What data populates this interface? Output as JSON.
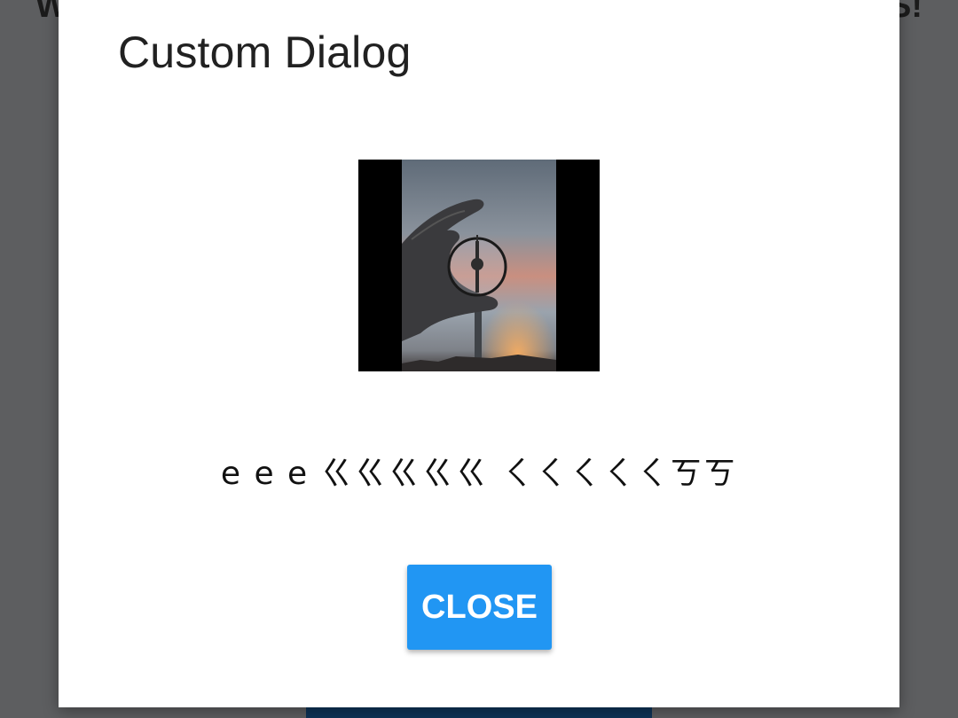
{
  "background": {
    "heading_left": "W",
    "heading_right": "S!",
    "overlay_color": "#5d5e60",
    "button_color": "#0e3357"
  },
  "dialog": {
    "title": "Custom Dialog",
    "image": {
      "description_icon": "photo-hand-holding-lens-tv-tower-icon"
    },
    "message": "e e e ㄍㄍㄍㄍㄍ ㄑㄑㄑㄑㄑㄎㄎ",
    "close_label": "CLOSE",
    "accent_color": "#2196f3"
  }
}
